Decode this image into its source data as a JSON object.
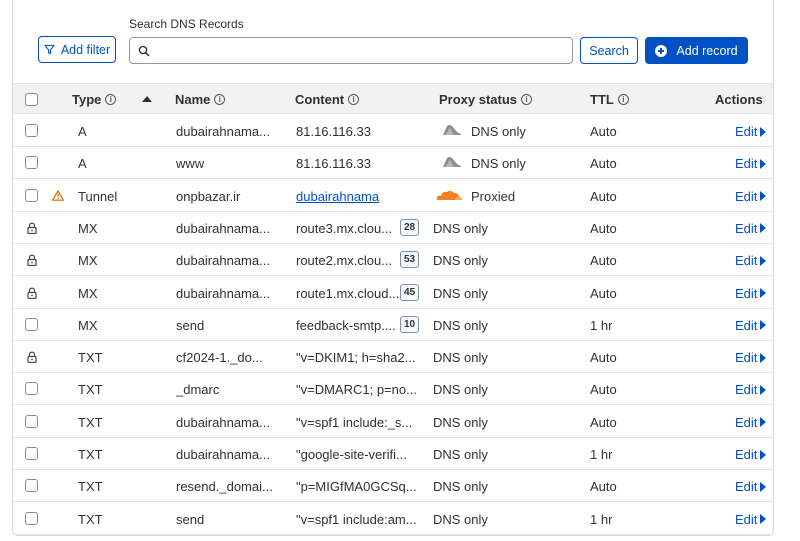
{
  "toolbar": {
    "add_filter_label": "Add filter",
    "search_label": "Search DNS Records",
    "search_value": "",
    "search_button_label": "Search",
    "add_record_label": "Add record"
  },
  "table": {
    "headers": {
      "type": "Type",
      "name": "Name",
      "content": "Content",
      "proxy_status": "Proxy status",
      "ttl": "TTL",
      "actions": "Actions"
    },
    "rows": [
      {
        "icon": "checkbox",
        "type": "A",
        "name": "dubairahnama...",
        "content": "81.16.116.33",
        "priority": "",
        "proxy": "DNS only",
        "cloud": "grey",
        "ttl": "Auto",
        "action": "Edit"
      },
      {
        "icon": "checkbox",
        "type": "A",
        "name": "www",
        "content": "81.16.116.33",
        "priority": "",
        "proxy": "DNS only",
        "cloud": "grey",
        "ttl": "Auto",
        "action": "Edit"
      },
      {
        "icon": "checkbox-warning",
        "type": "Tunnel",
        "name": "onpbazar.ir",
        "content": "dubairahnama",
        "priority": "",
        "proxy": "Proxied",
        "cloud": "orange",
        "ttl": "Auto",
        "action": "Edit"
      },
      {
        "icon": "lock",
        "type": "MX",
        "name": "dubairahnama...",
        "content": "route3.mx.clou...",
        "priority": "28",
        "proxy": "DNS only",
        "cloud": "",
        "ttl": "Auto",
        "action": "Edit"
      },
      {
        "icon": "lock",
        "type": "MX",
        "name": "dubairahnama...",
        "content": "route2.mx.clou...",
        "priority": "53",
        "proxy": "DNS only",
        "cloud": "",
        "ttl": "Auto",
        "action": "Edit"
      },
      {
        "icon": "lock",
        "type": "MX",
        "name": "dubairahnama...",
        "content": "route1.mx.cloud...",
        "priority": "45",
        "proxy": "DNS only",
        "cloud": "",
        "ttl": "Auto",
        "action": "Edit"
      },
      {
        "icon": "checkbox",
        "type": "MX",
        "name": "send",
        "content": "feedback-smtp....",
        "priority": "10",
        "proxy": "DNS only",
        "cloud": "",
        "ttl": "1 hr",
        "action": "Edit"
      },
      {
        "icon": "lock",
        "type": "TXT",
        "name": "cf2024-1._do...",
        "content": "\"v=DKIM1; h=sha2...",
        "priority": "",
        "proxy": "DNS only",
        "cloud": "",
        "ttl": "Auto",
        "action": "Edit"
      },
      {
        "icon": "checkbox",
        "type": "TXT",
        "name": "_dmarc",
        "content": "\"v=DMARC1; p=no...",
        "priority": "",
        "proxy": "DNS only",
        "cloud": "",
        "ttl": "Auto",
        "action": "Edit"
      },
      {
        "icon": "checkbox",
        "type": "TXT",
        "name": "dubairahnama...",
        "content": "\"v=spf1 include:_s...",
        "priority": "",
        "proxy": "DNS only",
        "cloud": "",
        "ttl": "Auto",
        "action": "Edit"
      },
      {
        "icon": "checkbox",
        "type": "TXT",
        "name": "dubairahnama...",
        "content": "\"google-site-verifi...",
        "priority": "",
        "proxy": "DNS only",
        "cloud": "",
        "ttl": "1 hr",
        "action": "Edit"
      },
      {
        "icon": "checkbox",
        "type": "TXT",
        "name": "resend._domai...",
        "content": "\"p=MIGfMA0GCSq...",
        "priority": "",
        "proxy": "DNS only",
        "cloud": "",
        "ttl": "Auto",
        "action": "Edit"
      },
      {
        "icon": "checkbox",
        "type": "TXT",
        "name": "send",
        "content": "\"v=spf1 include:am...",
        "priority": "",
        "proxy": "DNS only",
        "cloud": "",
        "ttl": "1 hr",
        "action": "Edit"
      }
    ]
  },
  "colors": {
    "accent": "#0051c3",
    "proxied_cloud": "#f38020",
    "dns_only_cloud": "#8e8e8e",
    "warning": "#d96a00"
  }
}
